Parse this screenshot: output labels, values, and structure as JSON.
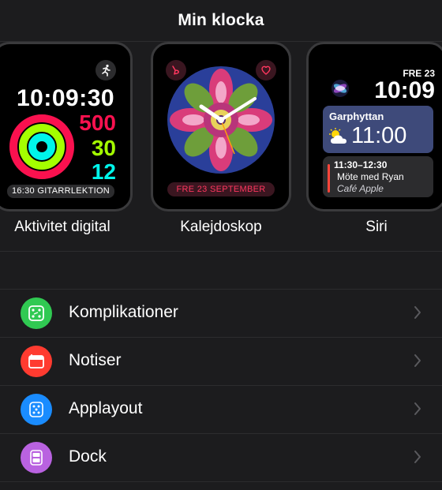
{
  "nav": {
    "title": "Min klocka"
  },
  "faces": [
    {
      "name": "Aktivitet digital",
      "time": "10:09:30",
      "move": "500",
      "exercise": "30",
      "stand": "12",
      "event": "16:30 GITARRLEKTION",
      "icon": "running-figure-icon",
      "colors": {
        "move": "#fa114f",
        "exercise": "#a4ff00",
        "stand": "#00f5ea"
      }
    },
    {
      "name": "Kalejdoskop",
      "date": "FRE 23 SEPTEMBER",
      "icons": [
        "breathe-icon",
        "heart-icon"
      ],
      "accent": "#ff375f"
    },
    {
      "name": "Siri",
      "date": "FRE 23",
      "time": "10:09",
      "weather": {
        "location": "Garphyttan",
        "temp": "11:00",
        "icon": "partly-cloudy-icon"
      },
      "calendar": {
        "time": "11:30–12:30",
        "title": "Möte med Ryan",
        "place": "Café Apple"
      }
    }
  ],
  "settings": [
    {
      "label": "Komplikationer",
      "icon": "complications-icon",
      "color": "#30c952"
    },
    {
      "label": "Notiser",
      "icon": "notifications-icon",
      "color": "#ff3b30"
    },
    {
      "label": "Applayout",
      "icon": "app-layout-icon",
      "color": "#1a8cff"
    },
    {
      "label": "Dock",
      "icon": "dock-icon",
      "color": "#b962e0"
    }
  ]
}
